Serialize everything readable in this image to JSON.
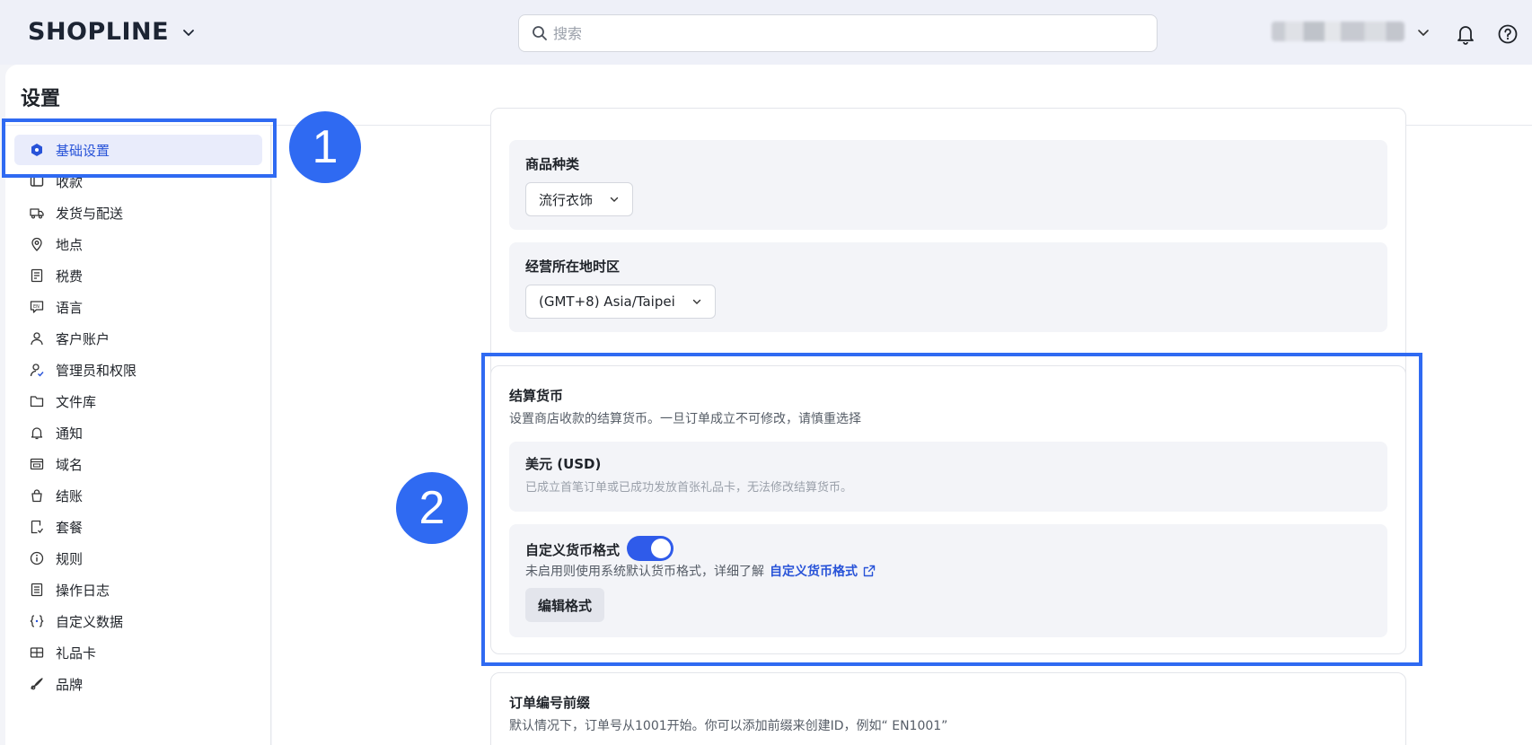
{
  "topbar": {
    "logo": "SHOPLINE",
    "search_placeholder": "搜索"
  },
  "page": {
    "title": "设置"
  },
  "sidebar": {
    "items": [
      {
        "label": "基础设置",
        "icon": "hexagon-settings-icon",
        "active": true
      },
      {
        "label": "收款",
        "icon": "payment-icon"
      },
      {
        "label": "发货与配送",
        "icon": "truck-icon"
      },
      {
        "label": "地点",
        "icon": "location-pin-icon"
      },
      {
        "label": "税费",
        "icon": "tax-receipt-icon"
      },
      {
        "label": "语言",
        "icon": "language-en-icon"
      },
      {
        "label": "客户账户",
        "icon": "user-icon"
      },
      {
        "label": "管理员和权限",
        "icon": "user-permission-icon"
      },
      {
        "label": "文件库",
        "icon": "folder-icon"
      },
      {
        "label": "通知",
        "icon": "bell-icon"
      },
      {
        "label": "域名",
        "icon": "domain-icon"
      },
      {
        "label": "结账",
        "icon": "shopping-bag-icon"
      },
      {
        "label": "套餐",
        "icon": "plan-icon"
      },
      {
        "label": "规则",
        "icon": "info-circle-icon"
      },
      {
        "label": "操作日志",
        "icon": "log-icon"
      },
      {
        "label": "自定义数据",
        "icon": "custom-data-icon"
      },
      {
        "label": "礼品卡",
        "icon": "gift-card-icon"
      },
      {
        "label": "品牌",
        "icon": "brand-icon"
      }
    ]
  },
  "store_info": {
    "category_label": "商品种类",
    "category_value": "流行衣饰",
    "timezone_label": "经营所在地时区",
    "timezone_value": "(GMT+8) Asia/Taipei"
  },
  "currency": {
    "title": "结算货币",
    "description": "设置商店收款的结算货币。一旦订单成立不可修改，请慎重选择",
    "currency_name": "美元 (USD)",
    "currency_note": "已成立首笔订单或已成功发放首张礼品卡，无法修改结算货币。",
    "custom_format_label": "自定义货币格式",
    "custom_format_enabled": true,
    "custom_format_desc": "未启用则使用系统默认货币格式，详细了解",
    "custom_format_link": "自定义货币格式",
    "edit_button": "编辑格式"
  },
  "order_prefix": {
    "title": "订单编号前缀",
    "description": "默认情况下，订单号从1001开始。你可以添加前缀来创建ID，例如“ EN1001”"
  },
  "annotations": {
    "badge_1": "1",
    "badge_2": "2",
    "color": "#2f6af2"
  },
  "colors": {
    "accent": "#2853d8",
    "toggle": "#2f5bea",
    "active_bg": "#e9ecfb"
  }
}
